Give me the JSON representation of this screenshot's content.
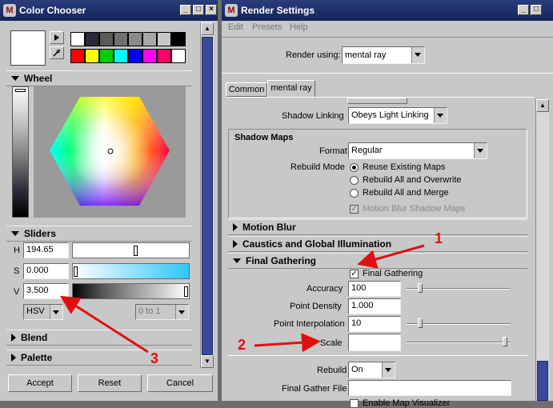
{
  "color_chooser": {
    "title": "Color Chooser",
    "wheel_label": "Wheel",
    "sliders_label": "Sliders",
    "h_label": "H",
    "s_label": "S",
    "v_label": "V",
    "h_value": "194.65",
    "s_value": "0.000",
    "v_value": "3.500",
    "mode": "HSV",
    "range": "0 to 1",
    "blend_label": "Blend",
    "palette_label": "Palette",
    "accept": "Accept",
    "reset": "Reset",
    "cancel": "Cancel",
    "swatches_row1": [
      "#ffffff",
      "#2a2a3a",
      "#5a5a5a",
      "#707070",
      "#8a8a8a",
      "#a8a8a8",
      "#c8c8c8",
      "#000000"
    ],
    "swatches_row2": [
      "#ff0000",
      "#ffff00",
      "#00cc00",
      "#00ffff",
      "#0000ff",
      "#ff00ff",
      "#ff0066",
      "#ffffff"
    ]
  },
  "render_settings": {
    "title": "Render Settings",
    "menu": [
      "Edit",
      "Presets",
      "Help"
    ],
    "render_using_label": "Render using:",
    "render_using_value": "mental ray",
    "tabs": [
      "Common",
      "mental ray"
    ],
    "shadow_linking_label": "Shadow Linking",
    "shadow_linking_value": "Obeys Light Linking",
    "shadow_maps_label": "Shadow Maps",
    "format_label": "Format",
    "format_value": "Regular",
    "rebuild_mode_label": "Rebuild Mode",
    "rebuild_options": [
      "Reuse Existing Maps",
      "Rebuild All and Overwrite",
      "Rebuild All and Merge"
    ],
    "motion_blur_shadow_maps": "Motion Blur Shadow Maps",
    "motion_blur": "Motion Blur",
    "caustics": "Caustics and Global Illumination",
    "final_gathering": "Final Gathering",
    "final_gathering_check": "Final Gathering",
    "accuracy_label": "Accuracy",
    "accuracy_value": "100",
    "point_density_label": "Point Density",
    "point_density_value": "1.000",
    "point_interp_label": "Point Interpolation",
    "point_interp_value": "10",
    "scale_label": "Scale",
    "rebuild_label": "Rebuild",
    "rebuild_value": "On",
    "final_gather_file_label": "Final Gather File",
    "enable_map_label": "Enable Map Visualizer"
  },
  "annotations": {
    "n1": "1",
    "n2": "2",
    "n3": "3"
  }
}
